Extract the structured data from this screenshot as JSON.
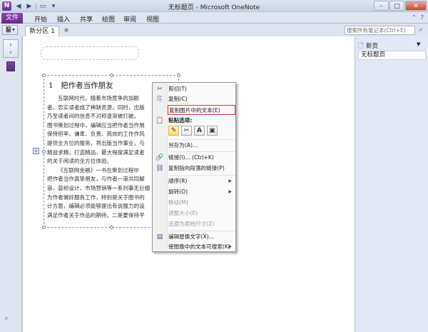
{
  "titlebar": {
    "app_icon": "N",
    "window_title": "无标题页 - Microsoft OneNote",
    "quick_access": [
      "back-icon",
      "forward-icon",
      "dock-icon",
      "customize-qat-icon"
    ],
    "minimize": "–",
    "maximize": "□",
    "close": "✕"
  },
  "ribbon": {
    "file_label": "文件",
    "tabs": [
      "开始",
      "插入",
      "共享",
      "绘图",
      "审阅",
      "视图"
    ],
    "minimize_glyph": "⌃",
    "help_glyph": "?"
  },
  "sections": {
    "notebook_glyph": "📓▾",
    "current_section": "新分区 1",
    "add_glyph": "✱",
    "search_placeholder": "搜索所有笔记本(Ctrl+E)",
    "search_glyph": "⌕"
  },
  "leftnav": {
    "expand_glyph": "›",
    "expand_text": "›"
  },
  "image_text": {
    "heading": "1　把作者当作朋友",
    "lines": [
      {
        "text": "互联网时代，随着市场竞争的加剧",
        "indent": true
      },
      {
        "text": "者、忠实读者成了稀缺资源，同时，出版",
        "indent": false
      },
      {
        "text": "乃至读者间的信息不对称逐渐被打破。",
        "indent": false
      },
      {
        "text": "图书策划过程中，编辑应当把作者当作朋",
        "indent": false
      },
      {
        "text": "保持担率、谦卑、负责、高效的工作作风",
        "indent": false
      },
      {
        "text": "提供全方位的服务，将出版当作事业，与",
        "indent": false
      },
      {
        "text": "精益求精，打造精品，最大程度满足读者",
        "indent": false
      },
      {
        "text": "的关于阅读的全方位体验。",
        "indent": false
      },
      {
        "text": "《互联网金融》一书在策划过程中",
        "indent": true
      },
      {
        "text": "把作者当作真挚朋友，与作者一道共同解",
        "indent": false
      },
      {
        "text": "容、装帧设计、市场营销等一系列事无巨细",
        "indent": false
      },
      {
        "text": "为作者做好服务工作，特别是关于图书的",
        "indent": false
      },
      {
        "text": "计方面，编辑必须能够提出有说服力的设",
        "indent": false
      },
      {
        "text": "满足作者关于作品的期待。二是要保持平",
        "indent": false
      }
    ]
  },
  "context_menu": {
    "items": [
      {
        "icon": "✂",
        "label": "剪切(T)"
      },
      {
        "icon": "⎘",
        "label": "复制(C)"
      },
      {
        "icon": "",
        "label": "复制图片中的文本(E)"
      },
      {
        "icon": "📋",
        "label": "粘贴选项:"
      },
      {
        "icon": "",
        "label": "另存为(A)..."
      },
      {
        "icon": "🔗",
        "label": "链接(I)...   (Ctrl+K)"
      },
      {
        "icon": "⛓",
        "label": "复制指向段落的链接(P)"
      },
      {
        "icon": "",
        "label": "顺序(R)"
      },
      {
        "icon": "",
        "label": "旋转(O)"
      },
      {
        "icon": "",
        "label": "移动(M)"
      },
      {
        "icon": "",
        "label": "调整大小(E)"
      },
      {
        "icon": "",
        "label": "还原为原始尺寸(Z)"
      },
      {
        "icon": "▤",
        "label": "编辑替换文字(X)..."
      },
      {
        "icon": "",
        "label": "使图像中的文本可搜索(K)"
      }
    ],
    "paste_options": [
      "✎",
      "✂",
      "A",
      "▣"
    ],
    "submenu_arrow": "▶"
  },
  "pages": {
    "new_page_icon": "🗋",
    "new_page_label": "新页",
    "dropdown_glyph": "▼",
    "list": [
      "无标题页"
    ]
  },
  "bottom_glyph": "⌕"
}
